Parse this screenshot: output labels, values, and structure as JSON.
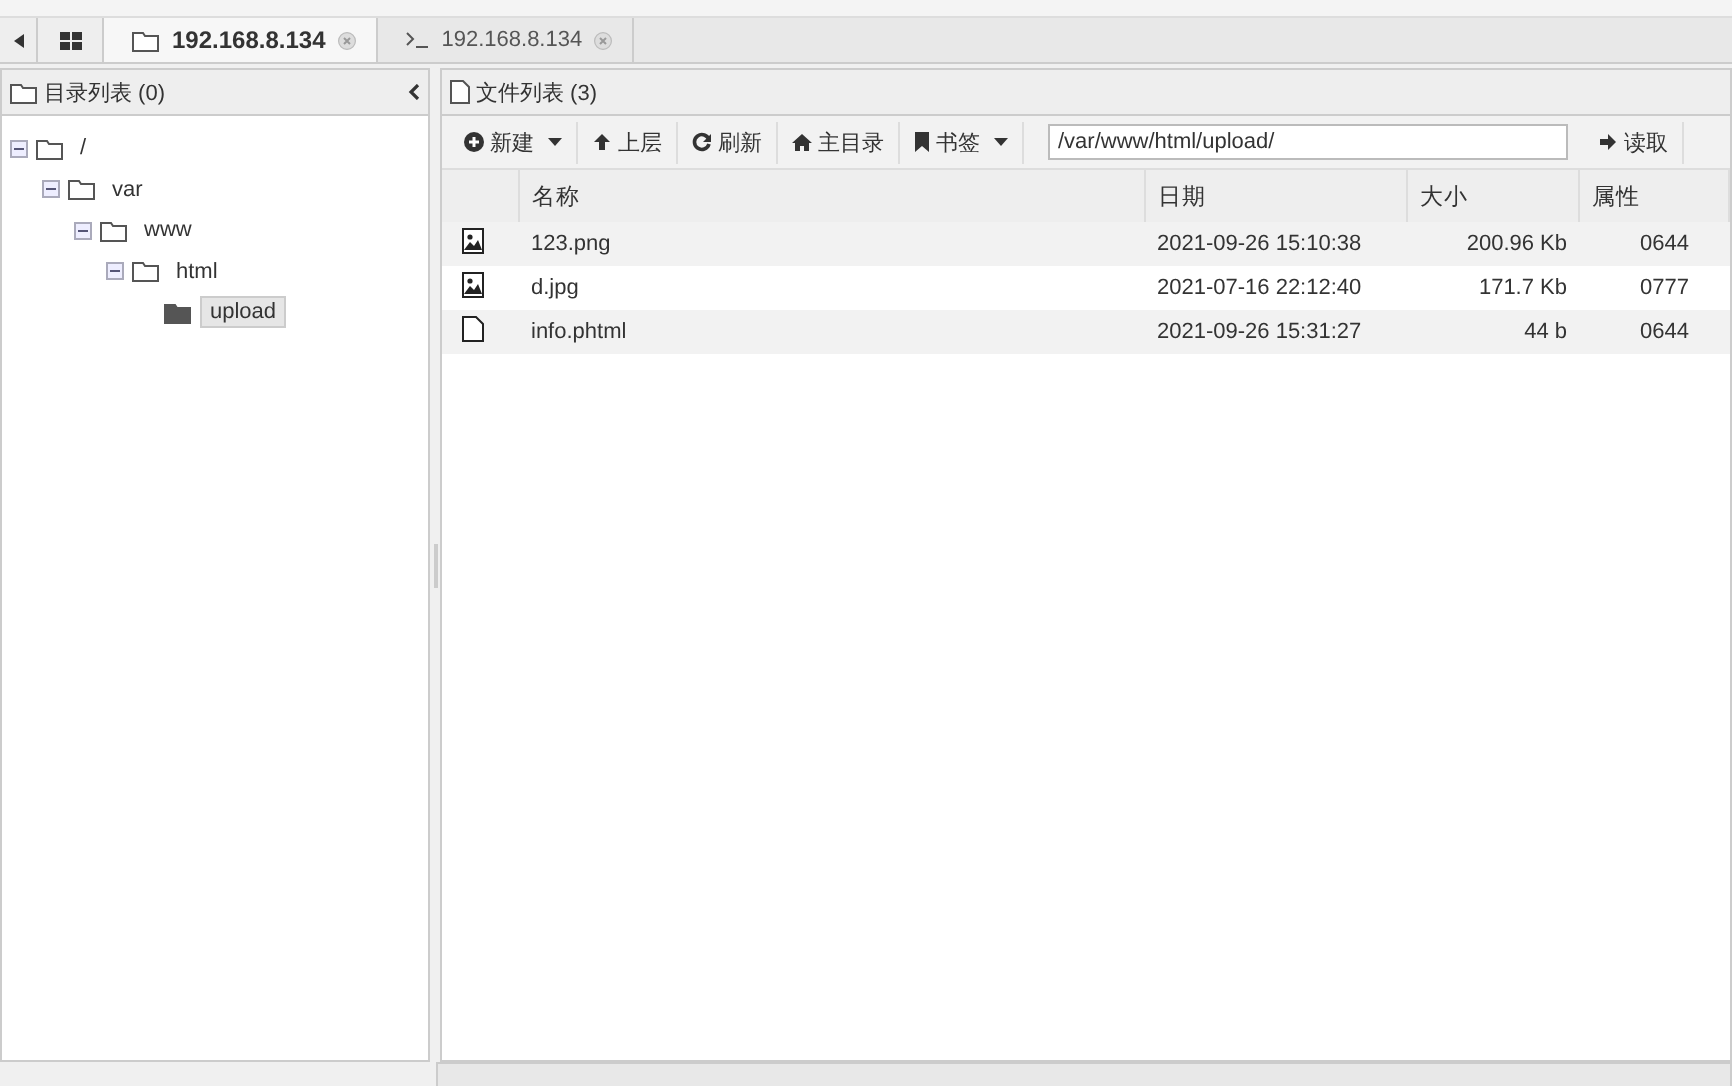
{
  "tabs": [
    {
      "kind": "files",
      "label": "192.168.8.134",
      "selected": true
    },
    {
      "kind": "terminal",
      "label": "192.168.8.134",
      "selected": false
    }
  ],
  "dir_panel": {
    "title": "目录列表 (0)",
    "tree": [
      {
        "label": "/",
        "expanded": true,
        "selected": false,
        "children": [
          {
            "label": "var",
            "expanded": true,
            "selected": false,
            "children": [
              {
                "label": "www",
                "expanded": true,
                "selected": false,
                "children": [
                  {
                    "label": "html",
                    "expanded": true,
                    "selected": false,
                    "children": [
                      {
                        "label": "upload",
                        "selected": true
                      }
                    ]
                  }
                ]
              }
            ]
          }
        ]
      }
    ]
  },
  "file_panel": {
    "title": "文件列表 (3)",
    "toolbar": [
      {
        "label": "新建",
        "dropdown": true
      },
      {
        "label": "上层",
        "dropdown": false
      },
      {
        "label": "刷新",
        "dropdown": false
      },
      {
        "label": "主目录",
        "dropdown": false
      },
      {
        "label": "书签",
        "dropdown": true
      }
    ],
    "path": "/var/www/html/upload/",
    "read_button": "读取",
    "columns": [
      "名称",
      "日期",
      "大小",
      "属性"
    ],
    "rows": [
      {
        "kind": "image",
        "name": "123.png",
        "date": "2021-09-26 15:10:38",
        "size": "200.96 Kb",
        "mode": "0644"
      },
      {
        "kind": "image",
        "name": "d.jpg",
        "date": "2021-07-16 22:12:40",
        "size": "171.7 Kb",
        "mode": "0777"
      },
      {
        "kind": "file",
        "name": "info.phtml",
        "date": "2021-09-26 15:31:27",
        "size": "44 b",
        "mode": "0644"
      }
    ]
  }
}
